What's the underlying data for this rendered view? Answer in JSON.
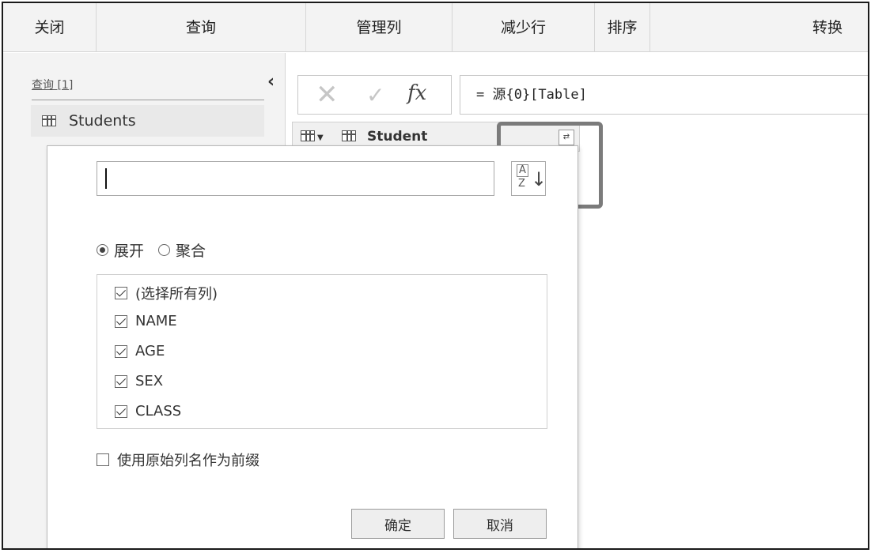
{
  "ribbon": {
    "groups": [
      "关闭",
      "查询",
      "管理列",
      "减少行",
      "排序",
      "转换"
    ]
  },
  "queries_pane": {
    "label": "查询 [1]",
    "collapse_icon": "chevron-left-icon",
    "items": [
      {
        "name": "Students",
        "icon": "table-icon"
      }
    ]
  },
  "formula_bar": {
    "cancel_symbol": "✕",
    "commit_symbol": "✓",
    "fx_label": "fx",
    "formula": "= 源{0}[Table]"
  },
  "column": {
    "title": "Student",
    "expand_icon": "expand-columns-icon"
  },
  "expand_panel": {
    "search_value": "",
    "sort_icon": "sort-az-icon",
    "mode_options": [
      {
        "label": "展开",
        "selected": true
      },
      {
        "label": "聚合",
        "selected": false
      }
    ],
    "columns": [
      {
        "label": "(选择所有列)",
        "checked": true
      },
      {
        "label": "NAME",
        "checked": true
      },
      {
        "label": "AGE",
        "checked": true
      },
      {
        "label": "SEX",
        "checked": true
      },
      {
        "label": "CLASS",
        "checked": true
      }
    ],
    "prefix_label": "使用原始列名作为前缀",
    "prefix_checked": false,
    "ok_label": "确定",
    "cancel_label": "取消"
  },
  "colors": {
    "ribbon_bg": "#f3f3f3",
    "highlight_border": "#7b7b7b"
  }
}
